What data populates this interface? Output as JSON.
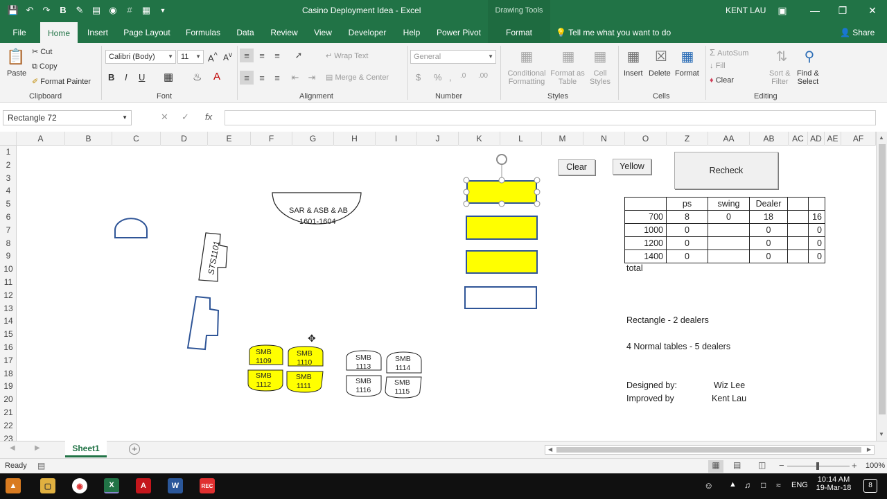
{
  "window": {
    "title": "Casino Deployment Idea  -  Excel",
    "context_tab_group": "Drawing Tools",
    "user": "KENT LAU",
    "accent": "#217346"
  },
  "qat": [
    "save-icon",
    "undo-icon",
    "redo-icon",
    "bold-icon",
    "format-icon",
    "form-icon",
    "camera-icon",
    "hash-icon",
    "table-icon",
    "customize-icon"
  ],
  "tabs": [
    "File",
    "Home",
    "Insert",
    "Page Layout",
    "Formulas",
    "Data",
    "Review",
    "View",
    "Developer",
    "Help",
    "Power Pivot",
    "Format"
  ],
  "tell_me": "Tell me what you want to do",
  "share": "Share",
  "ribbon": {
    "clipboard": {
      "paste": "Paste",
      "cut": "Cut",
      "copy": "Copy",
      "format_painter": "Format Painter",
      "label": "Clipboard"
    },
    "font": {
      "font_name": "Calibri (Body)",
      "font_size": "11",
      "label": "Font"
    },
    "alignment": {
      "wrap_text": "Wrap Text",
      "merge_center": "Merge & Center",
      "label": "Alignment"
    },
    "number": {
      "format": "General",
      "label": "Number"
    },
    "styles": {
      "conditional": "Conditional",
      "formatting": "Formatting",
      "format_as": "Format as",
      "table": "Table",
      "cell": "Cell",
      "styles": "Styles",
      "label": "Styles"
    },
    "cells": {
      "insert": "Insert",
      "delete": "Delete",
      "format": "Format",
      "label": "Cells"
    },
    "editing": {
      "autosum": "AutoSum",
      "fill": "Fill",
      "clear": "Clear",
      "sort": "Sort &",
      "filter": "Filter",
      "find": "Find &",
      "select": "Select",
      "label": "Editing"
    }
  },
  "formula_bar": {
    "name_box": "Rectangle 72",
    "value": ""
  },
  "columns": [
    "A",
    "B",
    "C",
    "D",
    "E",
    "F",
    "G",
    "H",
    "I",
    "J",
    "K",
    "L",
    "M",
    "N",
    "O",
    "Z",
    "AA",
    "AB",
    "AC",
    "AD",
    "AE",
    "AF"
  ],
  "rows": [
    "1",
    "2",
    "3",
    "4",
    "5",
    "6",
    "7",
    "8",
    "9",
    "10",
    "11",
    "12",
    "13",
    "14",
    "15",
    "16",
    "17",
    "18",
    "19",
    "20",
    "21",
    "22",
    "23"
  ],
  "sheet": {
    "buttons": {
      "clear": "Clear",
      "yellow": "Yellow",
      "recheck": "Recheck"
    },
    "table": {
      "headers": [
        "",
        "ps",
        "swing",
        "Dealer",
        "",
        ""
      ],
      "rows": [
        [
          "700",
          "8",
          "0",
          "18",
          "",
          "16"
        ],
        [
          "1000",
          "0",
          "",
          "0",
          "",
          "0"
        ],
        [
          "1200",
          "0",
          "",
          "0",
          "",
          "0"
        ],
        [
          "1400",
          "0",
          "",
          "0",
          "",
          "0"
        ]
      ],
      "total_label": "total"
    },
    "notes": {
      "rect_note": "Rectangle - 2 dealers",
      "normal_note": "4 Normal tables - 5 dealers",
      "designed_label": "Designed by:",
      "designed_name": "Wiz Lee",
      "improved_label": "Improved by",
      "improved_name": "Kent Lau"
    },
    "shapes": {
      "arc_line1": "SAR & ASB & AB",
      "arc_line2": "1601-1604",
      "sts": "STS1101",
      "smb": [
        {
          "id": "1109",
          "fill": "#ffff00"
        },
        {
          "id": "1110",
          "fill": "#ffff00"
        },
        {
          "id": "1112",
          "fill": "#ffff00"
        },
        {
          "id": "1111",
          "fill": "#ffff00"
        },
        {
          "id": "1113",
          "fill": "#ffffff"
        },
        {
          "id": "1114",
          "fill": "#ffffff"
        },
        {
          "id": "1116",
          "fill": "#ffffff"
        },
        {
          "id": "1115",
          "fill": "#ffffff"
        }
      ],
      "smb_prefix": "SMB",
      "rect_fills": [
        "#ffff00",
        "#ffff00",
        "#ffff00",
        "#ffffff"
      ]
    }
  },
  "sheet_tab": "Sheet1",
  "status": {
    "ready": "Ready",
    "zoom": "100%"
  },
  "taskbar": {
    "time": "10:14 AM",
    "date": "19-Mar-18",
    "lang": "ENG",
    "notifications": "8"
  }
}
